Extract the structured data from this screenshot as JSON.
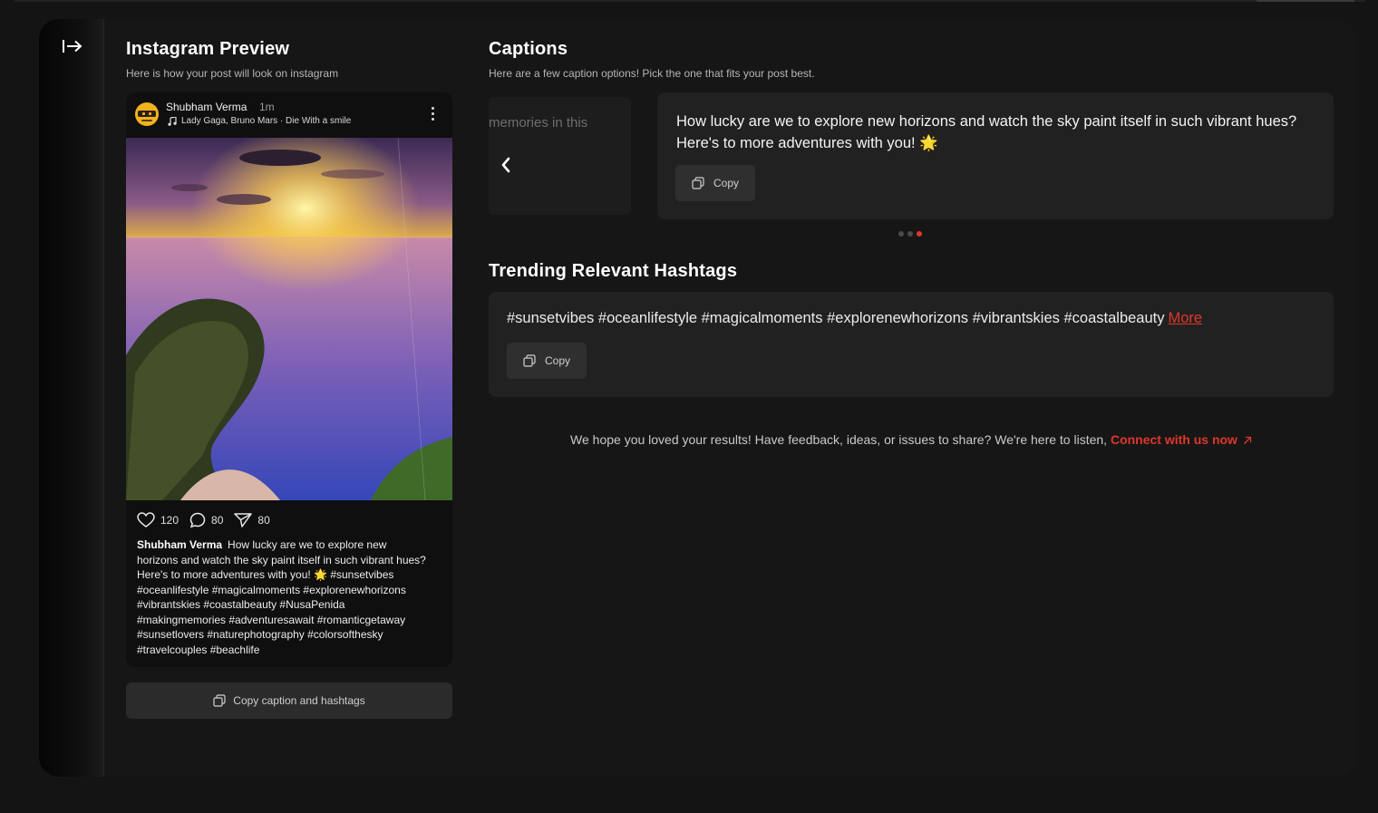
{
  "sidebar": {
    "toggle_icon": "expand-sidebar-icon"
  },
  "preview": {
    "title": "Instagram Preview",
    "subtitle": "Here is how your post will look on instagram",
    "post": {
      "username": "Shubham Verma",
      "time": "1m",
      "music": "Lady Gaga, Bruno Mars · Die With a smile",
      "likes": "120",
      "comments": "80",
      "shares": "80",
      "caption_author": "Shubham Verma",
      "caption_text": "How lucky are we to explore new horizons and watch the sky paint itself in such vibrant hues? Here's to more adventures with you! 🌟 #sunsetvibes #oceanlifestyle #magicalmoments #explorenewhorizons #vibrantskies #coastalbeauty #NusaPenida #makingmemories #adventuresawait #romanticgetaway #sunsetlovers #naturephotography #colorsofthesky #travelcouples #beachlife"
    },
    "copy_all_label": "Copy caption and hashtags"
  },
  "captions": {
    "title": "Captions",
    "subtitle": "Here are a few caption options! Pick the one that fits your post best.",
    "previous_snippet": "memories in this",
    "current_text": "How lucky are we to explore new horizons and watch the sky paint itself in such vibrant hues? Here's to more adventures with you! 🌟",
    "copy_label": "Copy",
    "pagination": {
      "total": 3,
      "active": 3
    }
  },
  "hashtags": {
    "title": "Trending Relevant Hashtags",
    "text": "#sunsetvibes #oceanlifestyle #magicalmoments #explorenewhorizons #vibrantskies #coastalbeauty",
    "more_label": "More",
    "copy_label": "Copy"
  },
  "feedback": {
    "text": "We hope you loved your results! Have feedback, ideas, or issues to share? We're here to listen,",
    "link_label": "Connect with us now"
  },
  "colors": {
    "accent": "#e0372b",
    "background": "#141414",
    "card": "#212121"
  }
}
